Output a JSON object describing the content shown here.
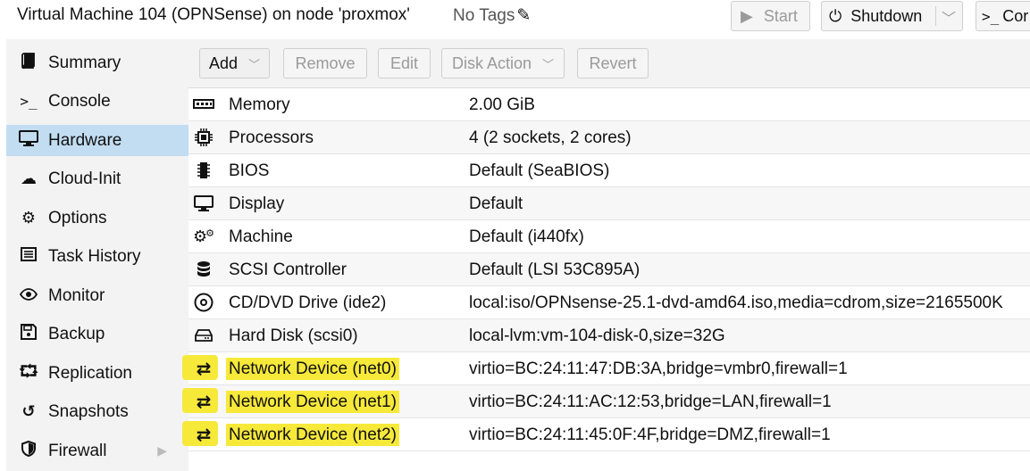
{
  "header": {
    "title": "Virtual Machine 104 (OPNSense) on node 'proxmox'",
    "tags": "No Tags",
    "buttons": {
      "start": "Start",
      "shutdown": "Shutdown",
      "console": "Cor"
    }
  },
  "sidebar": {
    "items": [
      {
        "label": "Summary",
        "icon": "book-icon"
      },
      {
        "label": "Console",
        "icon": "terminal-icon"
      },
      {
        "label": "Hardware",
        "icon": "desktop-icon",
        "active": true
      },
      {
        "label": "Cloud-Init",
        "icon": "cloud-icon"
      },
      {
        "label": "Options",
        "icon": "gear-icon"
      },
      {
        "label": "Task History",
        "icon": "list-icon"
      },
      {
        "label": "Monitor",
        "icon": "eye-icon"
      },
      {
        "label": "Backup",
        "icon": "floppy-icon"
      },
      {
        "label": "Replication",
        "icon": "retweet-icon"
      },
      {
        "label": "Snapshots",
        "icon": "history-icon"
      },
      {
        "label": "Firewall",
        "icon": "shield-icon"
      }
    ]
  },
  "toolbar": {
    "add": "Add",
    "remove": "Remove",
    "edit": "Edit",
    "disk_action": "Disk Action",
    "revert": "Revert"
  },
  "hardware": [
    {
      "name": "Memory",
      "value": "2.00 GiB",
      "icon": "memory-icon"
    },
    {
      "name": "Processors",
      "value": "4 (2 sockets, 2 cores)",
      "icon": "cpu-icon"
    },
    {
      "name": "BIOS",
      "value": "Default (SeaBIOS)",
      "icon": "microchip-icon"
    },
    {
      "name": "Display",
      "value": "Default",
      "icon": "desktop-icon"
    },
    {
      "name": "Machine",
      "value": "Default (i440fx)",
      "icon": "cogs-icon"
    },
    {
      "name": "SCSI Controller",
      "value": "Default (LSI 53C895A)",
      "icon": "database-icon"
    },
    {
      "name": "CD/DVD Drive (ide2)",
      "value": "local:iso/OPNsense-25.1-dvd-amd64.iso,media=cdrom,size=2165500K",
      "icon": "cdrom-icon"
    },
    {
      "name": "Hard Disk (scsi0)",
      "value": "local-lvm:vm-104-disk-0,size=32G",
      "icon": "hdd-icon"
    },
    {
      "name": "Network Device (net0)",
      "value": "virtio=BC:24:11:47:DB:3A,bridge=vmbr0,firewall=1",
      "icon": "exchange-icon",
      "highlighted": true
    },
    {
      "name": "Network Device (net1)",
      "value": "virtio=BC:24:11:AC:12:53,bridge=LAN,firewall=1",
      "icon": "exchange-icon",
      "highlighted": true
    },
    {
      "name": "Network Device (net2)",
      "value": "virtio=BC:24:11:45:0F:4F,bridge=DMZ,firewall=1",
      "icon": "exchange-icon",
      "highlighted": true
    }
  ],
  "colors": {
    "active_nav": "#c2ddf2",
    "highlight": "#f7e93a"
  }
}
